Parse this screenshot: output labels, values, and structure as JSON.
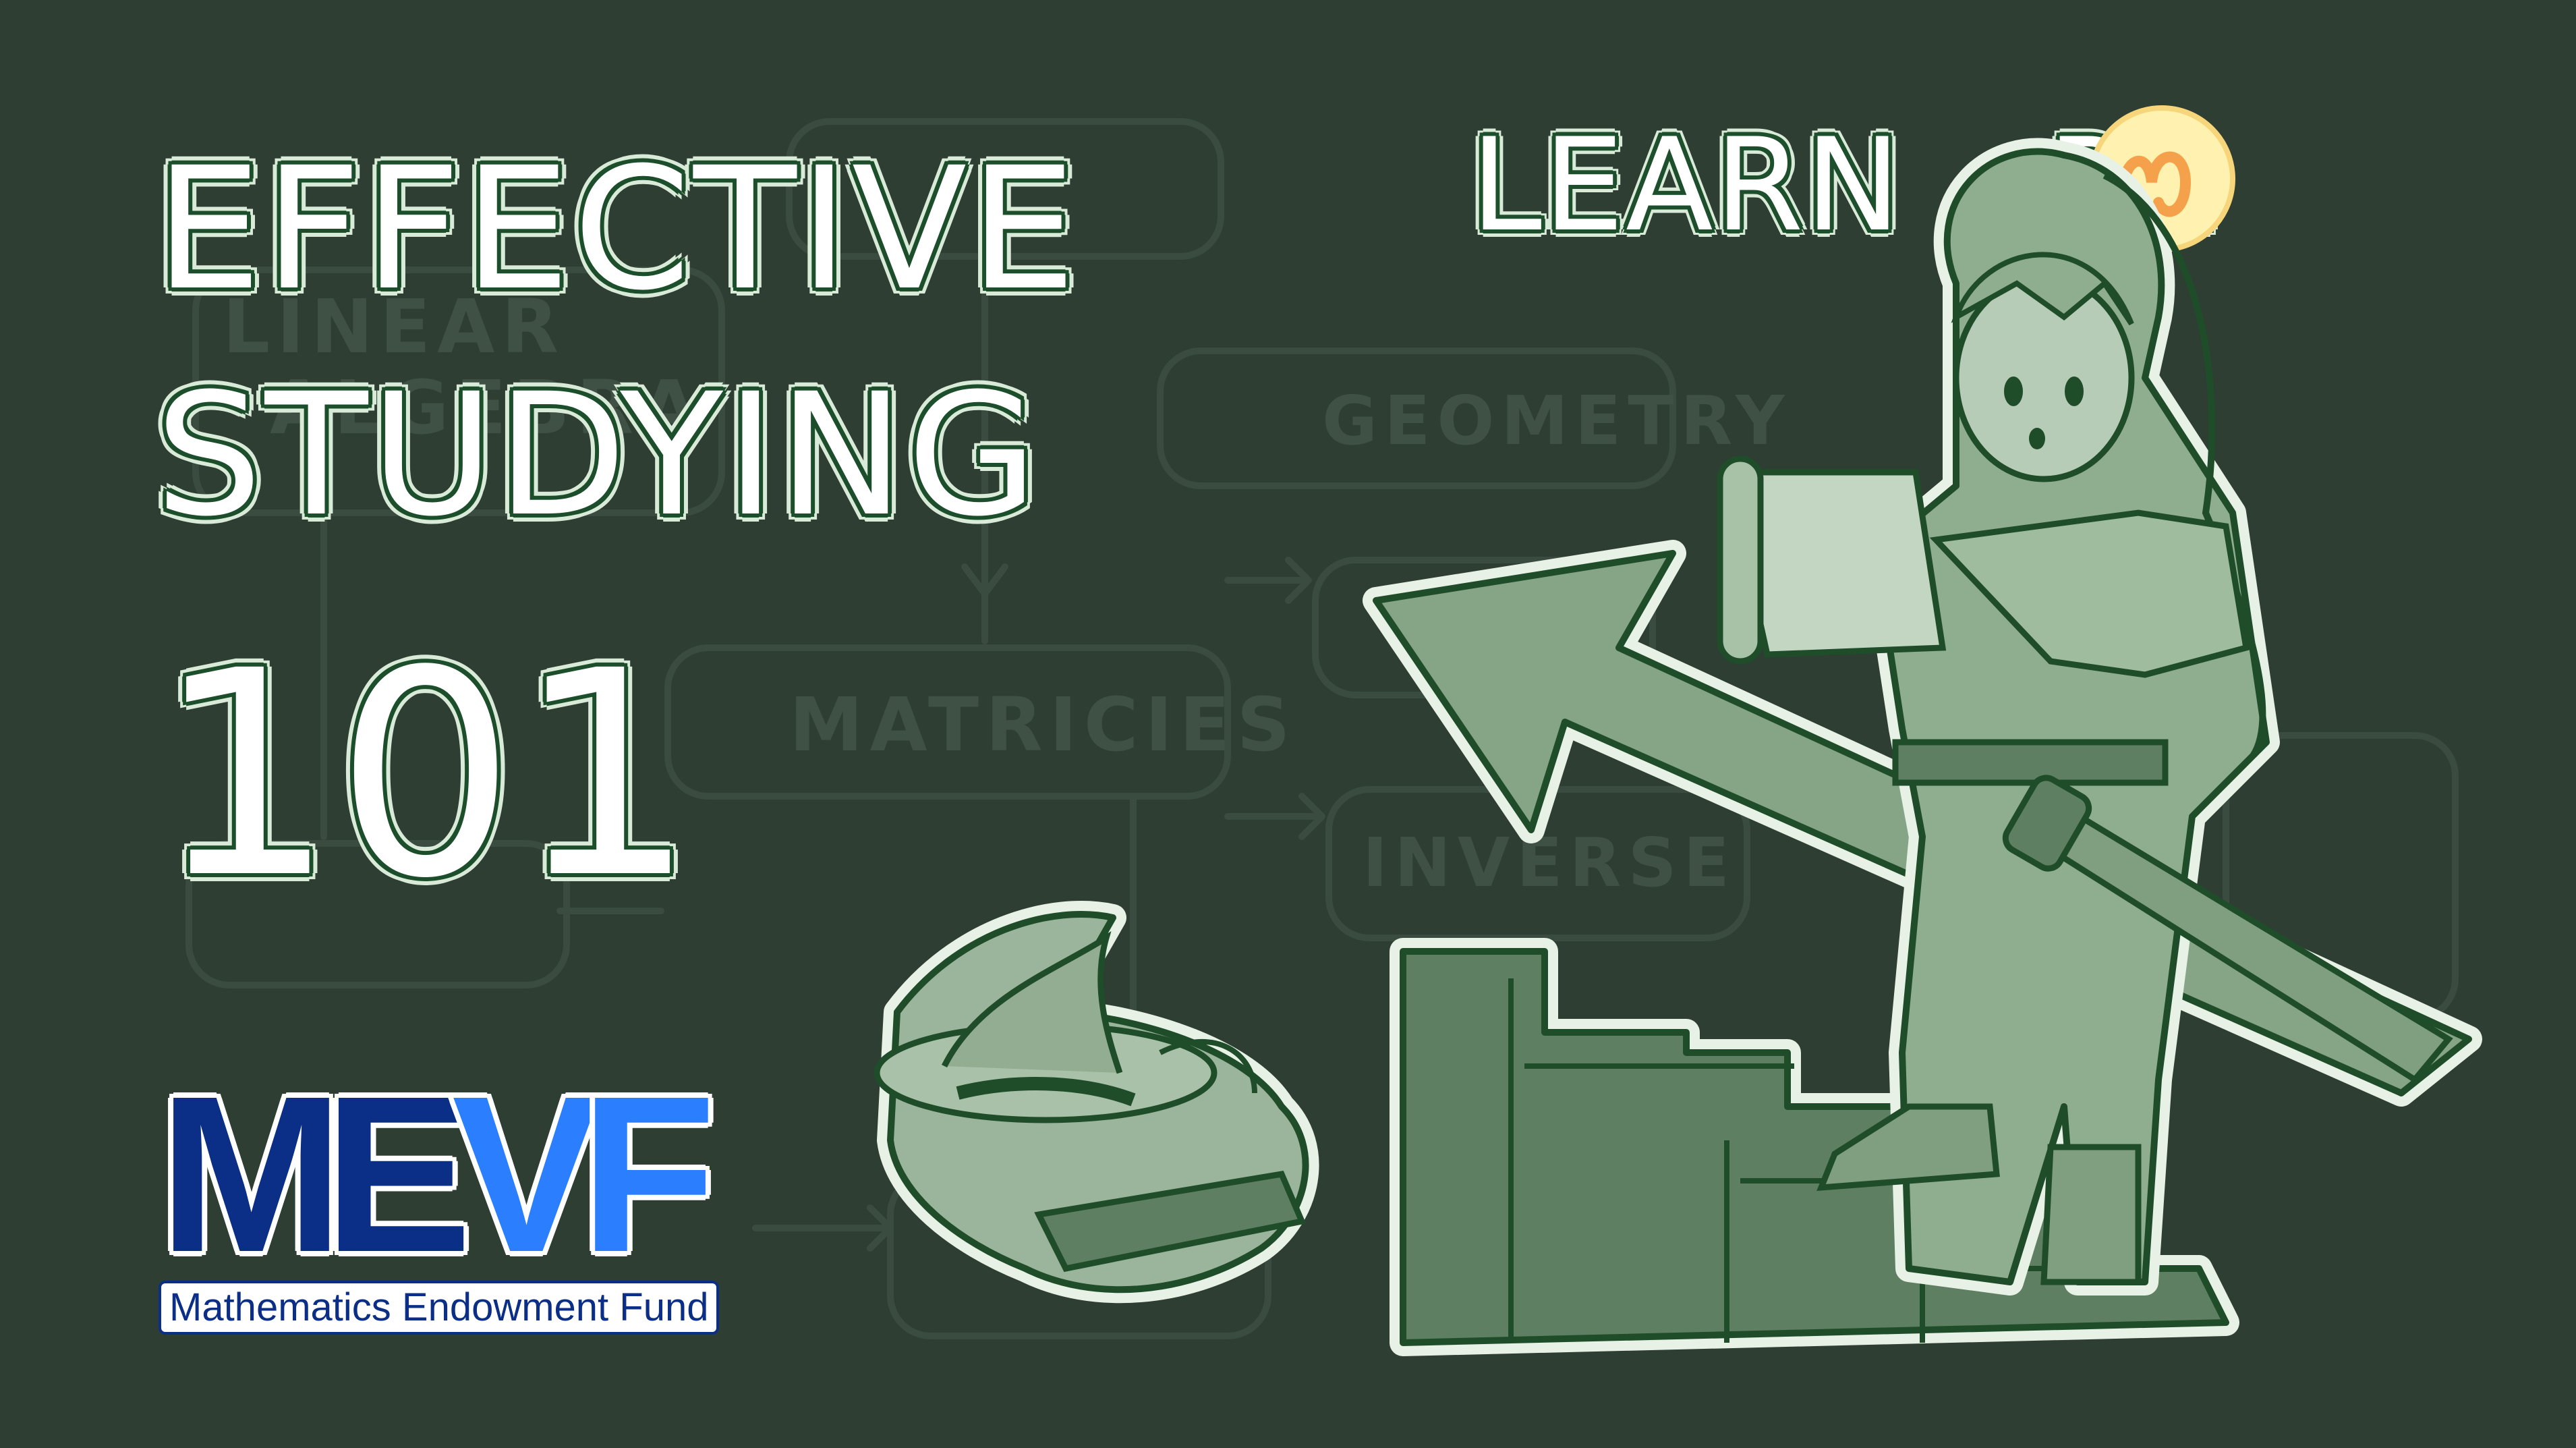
{
  "title": {
    "line1": "EFFECTIVE",
    "line2": "STUDYING",
    "line3": "101"
  },
  "brand": {
    "prefix": "LEARN",
    "suffix": "RE"
  },
  "logo": {
    "letter_m": "M",
    "letter_e": "E",
    "letter_v": "V",
    "letter_f": "F",
    "subtitle": "Mathematics Endowment Fund"
  },
  "background_words": {
    "linear_algebra_1": "LINEAR",
    "linear_algebra_2": "ALGEBRA",
    "geometry": "GEOMETRY",
    "matricies": "MATRICIES",
    "inverse": "INVERSE"
  },
  "colors": {
    "background": "#2e3e33",
    "title_text": "#ffffff",
    "title_outline": "#1d4f2c",
    "logo_dark_blue": "#0b2f86",
    "logo_light_blue": "#2b7fff",
    "illustration_green": "#9bb59c",
    "brand_logo_yellow": "#fff2b0",
    "brand_logo_orange": "#f5a04a"
  }
}
